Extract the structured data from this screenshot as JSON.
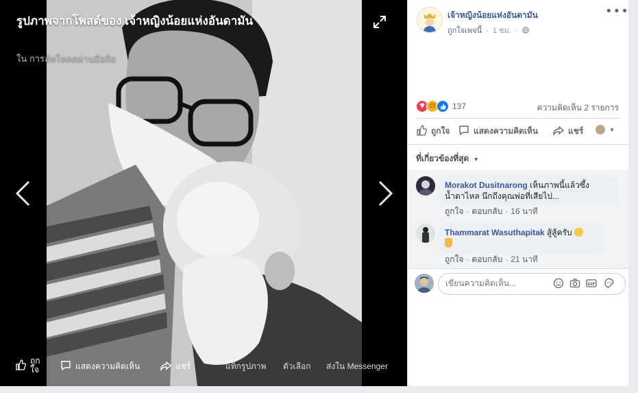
{
  "viewer": {
    "caption_title": "รูปภาพจากโพสต์ของ เจ้าหญิงน้อยแห่งอันดามัน",
    "caption_subtitle": "ใน การอัพโหลดผ่านมือถือ",
    "bottom": {
      "like_label_line1": "ถูก",
      "like_label_line2": "ใจ",
      "comment_label": "แสดงความคิดเห็น",
      "share_label": "แชร์",
      "tag_label": "แท็กรูปภาพ",
      "options_label": "ตัวเลือก",
      "messenger_label": "ส่งใน Messenger"
    }
  },
  "post": {
    "page_name": "เจ้าหญิงน้อยแห่งอันดามัน",
    "like_page": "ถูกใจเพจนี้",
    "time": "1 ชม.",
    "reaction_count": "137",
    "comment_count_label": "ความคิดเห็น 2 รายการ",
    "actions": {
      "like": "ถูกใจ",
      "comment": "แสดงความคิดเห็น",
      "share": "แชร์"
    },
    "relevant_label": "ที่เกี่ยวข้องที่สุด"
  },
  "comments": [
    {
      "author": "Morakot Dusitnarong",
      "text_line1": "เห็นภาพนี้แล้วซึ้ง",
      "text_line2": "น้ำตาไหล นึกถึงคุณพ่อที่เสียไป...",
      "like": "ถูกใจ",
      "reply": "ตอบกลับ",
      "time": "16 นาที"
    },
    {
      "author": "Thammarat Wasuthapitak",
      "text": "สู้สู้ครับ",
      "like": "ถูกใจ",
      "reply": "ตอบกลับ",
      "time": "21 นาที"
    }
  ],
  "composer": {
    "placeholder": "เขียนความคิดเห็น..."
  },
  "colors": {
    "link_blue": "#385898",
    "like_blue": "#1877f2",
    "love_red": "#f33e58",
    "sad_yellow": "#f7b125"
  }
}
